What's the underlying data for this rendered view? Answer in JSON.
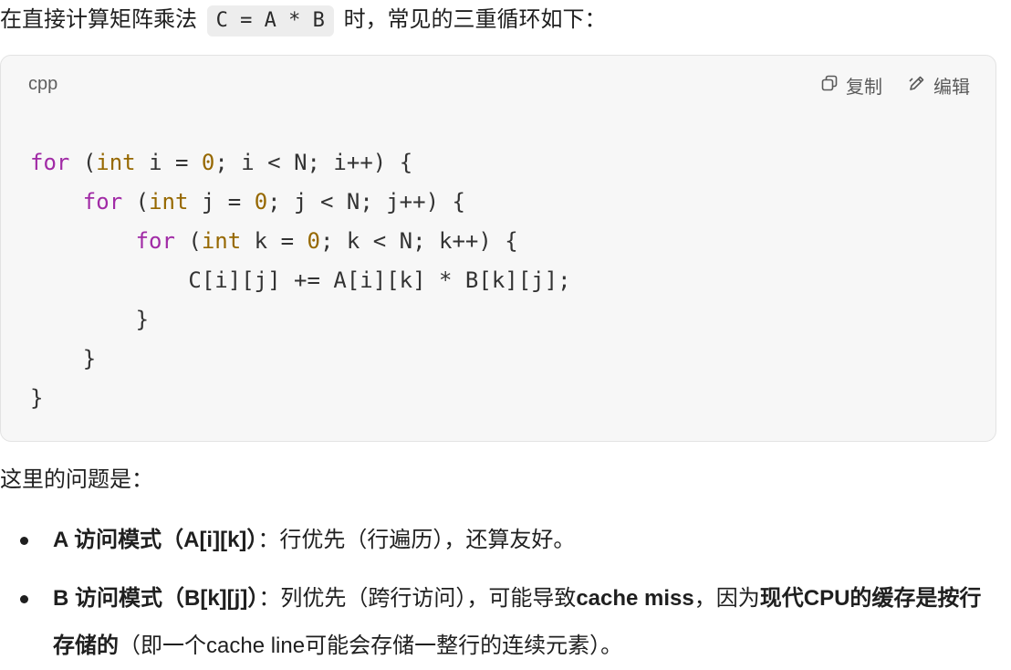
{
  "intro": {
    "before": "在直接计算矩阵乘法",
    "code": "C = A * B",
    "after": "时，常见的三重循环如下："
  },
  "code_block": {
    "language": "cpp",
    "copy_label": "复制",
    "edit_label": "编辑",
    "lines": [
      "for (int i = 0; i < N; i++) {",
      "    for (int j = 0; j < N; j++) {",
      "        for (int k = 0; k < N; k++) {",
      "            C[i][j] += A[i][k] * B[k][j];",
      "        }",
      "    }",
      "}"
    ]
  },
  "problem_heading": "这里的问题是：",
  "bullets": [
    {
      "strong": "A 访问模式（A[i][k]）",
      "text": "：行优先（行遍历），还算友好。"
    },
    {
      "strong": "B 访问模式（B[k][j]）",
      "text1": "：列优先（跨行访问），可能导致",
      "strong2": "cache miss",
      "text2": "，因为",
      "strong3": "现代CPU的缓存是按行存储的",
      "text3": "（即一个cache line可能会存储一整行的连续元素）。"
    }
  ]
}
